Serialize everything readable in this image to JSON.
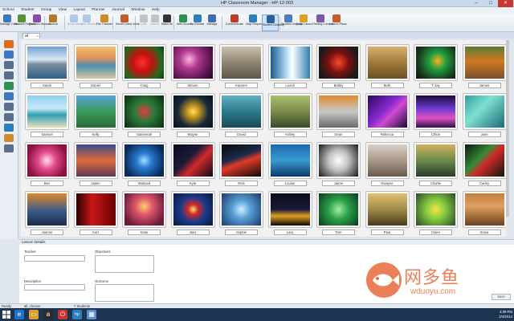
{
  "window": {
    "title": "HP Classroom Manager - HP-12-003",
    "min": "–",
    "max": "□",
    "close": "✕"
  },
  "menu": [
    "School",
    "Student",
    "Group",
    "View",
    "Layout",
    "Planner",
    "Journal",
    "Window",
    "Help"
  ],
  "toolbar": [
    {
      "label": "Manage Class",
      "icon": "manage-class-icon",
      "color": "#3a78c2"
    },
    {
      "label": "Student Register",
      "icon": "register-icon",
      "color": "#5a8f3a"
    },
    {
      "label": "Random Student",
      "icon": "dice-icon",
      "color": "#8b4aa8"
    },
    {
      "label": "Journal",
      "icon": "journal-icon",
      "color": "#b07a2a"
    },
    {
      "label": "Show Menu",
      "icon": "show-icon",
      "color": "#3a78c2",
      "disabled": true
    },
    {
      "label": "View Student",
      "icon": "view-icon",
      "color": "#3a78c2",
      "disabled": true
    },
    {
      "label": "File Transfer",
      "icon": "file-transfer-icon",
      "color": "#d18b2c"
    },
    {
      "label": "Send/Collect Work",
      "icon": "send-collect-icon",
      "color": "#c45b2a"
    },
    {
      "label": "Lock",
      "icon": "lock-icon",
      "color": "#666666",
      "disabled": true
    },
    {
      "label": "Unlock",
      "icon": "unlock-icon",
      "color": "#666666",
      "disabled": true
    },
    {
      "label": "Blank All",
      "icon": "blank-icon",
      "color": "#333333"
    },
    {
      "label": "Web Access",
      "icon": "web-icon",
      "color": "#2f8f4e"
    },
    {
      "label": "Co-Browse",
      "icon": "co-browse-icon",
      "color": "#2a7fbf"
    },
    {
      "label": "Manage",
      "icon": "manage-icon",
      "color": "#3f6fb0"
    },
    {
      "label": "Communicate",
      "icon": "chat-icon",
      "color": "#c0392b"
    },
    {
      "label": "Help Requests",
      "icon": "help-icon",
      "color": "#2a7fbf"
    },
    {
      "label": "Student Desktop",
      "icon": "desktop-icon",
      "color": "#2b5f9e",
      "active": true
    },
    {
      "label": "Student Desktop",
      "icon": "student-desktop-icon",
      "color": "#4b7db8"
    },
    {
      "label": "Quick Launch",
      "icon": "quick-launch-icon",
      "color": "#e0a020"
    },
    {
      "label": "Testing Console",
      "icon": "testing-icon",
      "color": "#7a5aa8"
    },
    {
      "label": "Lesson Plans",
      "icon": "lesson-plan-icon",
      "color": "#c45b2a"
    }
  ],
  "tab": {
    "label": "all",
    "close": "×"
  },
  "sidebar": [
    {
      "icon": "grid-view-icon",
      "color": "#e06a1e"
    },
    {
      "icon": "large-icons-icon",
      "color": "#3a78c2"
    },
    {
      "icon": "headset-icon",
      "color": "#5a6f8c"
    },
    {
      "icon": "print-icon",
      "color": "#5a6f8c"
    },
    {
      "icon": "globe-icon",
      "color": "#2f8f4e"
    },
    {
      "icon": "applications-icon",
      "color": "#3a78c2"
    },
    {
      "icon": "printer-icon",
      "color": "#5a6f8c"
    },
    {
      "icon": "devices-icon",
      "color": "#5a6f8c"
    },
    {
      "icon": "security-icon",
      "color": "#2a7fbf"
    },
    {
      "icon": "folder-icon",
      "color": "#d18b2c"
    },
    {
      "icon": "keyboard-icon",
      "color": "#5a6f8c"
    }
  ],
  "students": [
    {
      "name": "Sarah",
      "bg": "linear-gradient(#6f9fd0 0%,#d8e7f5 40%,#7b8ea0 55%,#2f5f88 100%)"
    },
    {
      "name": "Daniel",
      "bg": "linear-gradient(#f0c070 0%,#e0905a 35%,#4d8fb0 60%,#d9c9a0 100%)"
    },
    {
      "name": "Craig",
      "bg": "radial-gradient(circle at 45% 50%,#ff3030 0%,#c31010 35%,#1f6b20 75%,#0e3c10 100%)"
    },
    {
      "name": "Steven",
      "bg": "radial-gradient(circle at 40% 40%,#ffb3e0 0%,#b03a8f 30%,#5a1450 70%,#2a0626 100%)"
    },
    {
      "name": "Kareem",
      "bg": "linear-gradient(#c9c1ae 0%,#8d8473 50%,#5d5546 100%)"
    },
    {
      "name": "Leonil",
      "bg": "linear-gradient(90deg,#1a5d8f 0%,#c8e8ff 45%,#ffffff 55%,#2f7fb0 100%)"
    },
    {
      "name": "Bobby",
      "bg": "radial-gradient(circle at 50% 50%,#ff4a2a 0%,#7a1010 40%,#1a1a1a 80%)"
    },
    {
      "name": "Beth",
      "bg": "linear-gradient(#d8b070 0%,#a07a3a 50%,#6a4f25 100%)"
    },
    {
      "name": "T-Jay",
      "bg": "radial-gradient(circle at 55% 45%,#ffb020 0%,#20a040 30%,#1a3a20 70%,#0a150a 100%)"
    },
    {
      "name": "James",
      "bg": "linear-gradient(#5a7a3a 0%,#d07a20 45%,#7a5030 100%)"
    },
    {
      "name": "Samuel",
      "bg": "linear-gradient(#8fd0f0 0%,#c8eaf8 40%,#2f9fb0 60%,#e8e0c0 100%)"
    },
    {
      "name": "Kelly",
      "bg": "linear-gradient(#5aa0d8 0%,#3a9a5a 50%,#2a6a3a 100%)"
    },
    {
      "name": "Sameerah",
      "bg": "radial-gradient(circle at 50% 50%,#e04040 0%,#2a7a3a 40%,#0a2a10 100%)"
    },
    {
      "name": "Wayne",
      "bg": "radial-gradient(circle at 50% 50%,#ffe060 0%,#d0a020 20%,#1a2a3a 60%,#0a1018 100%)"
    },
    {
      "name": "David",
      "bg": "linear-gradient(#5fb0c0 0%,#2a7a8a 50%,#1a4a55 100%)"
    },
    {
      "name": "Ashley",
      "bg": "linear-gradient(#a8c070 0%,#7a8a4a 50%,#3a4a2a 100%)"
    },
    {
      "name": "Dean",
      "bg": "linear-gradient(#e08a30 0%,#c8c8c8 50%,#6a6a6a 100%)"
    },
    {
      "name": "Rebecca",
      "bg": "linear-gradient(135deg,#2a0a5a 0%,#8a2ad0 45%,#d04ad0 60%,#1a0a3a 100%)"
    },
    {
      "name": "Chloe",
      "bg": "linear-gradient(#1a0a3a 0%,#6a3ad0 40%,#e050c0 70%,#2a1050 100%)"
    },
    {
      "name": "Jane",
      "bg": "linear-gradient(135deg,#30a0a0 0%,#80e0d0 40%,#1a6a7a 100%)"
    },
    {
      "name": "Bev",
      "bg": "radial-gradient(circle at 50% 50%,#ffe0f0 0%,#e04a8a 35%,#8a1040 80%)"
    },
    {
      "name": "Jason",
      "bg": "linear-gradient(#3a4a8a 0%,#e06a3a 50%,#5a3a5a 100%)"
    },
    {
      "name": "Waheed",
      "bg": "radial-gradient(circle at 50% 50%,#a0e0ff 0%,#2a7ad0 30%,#0a2a5a 80%)"
    },
    {
      "name": "Kyla",
      "bg": "linear-gradient(135deg,#0a0a1a 0%,#1a1a3a 40%,#d02a2a 60%,#0a0a1a 100%)"
    },
    {
      "name": "Reis",
      "bg": "linear-gradient(160deg,#0a0a0a 0%,#1a2a4a 40%,#e03a2a 55%,#0a0a0a 100%)"
    },
    {
      "name": "Louise",
      "bg": "linear-gradient(#1a6ab0 0%,#3a9ad0 50%,#0a3a6a 100%)"
    },
    {
      "name": "Jaime",
      "bg": "radial-gradient(circle at 50% 50%,#ffffff 0%,#c0c0c0 40%,#1a1a1a 100%)"
    },
    {
      "name": "Dwayne",
      "bg": "linear-gradient(#d8d0c8 0%,#a89888 50%,#6a5a4a 100%)"
    },
    {
      "name": "Charlie",
      "bg": "linear-gradient(#d0b060 0%,#6a8a4a 50%,#2a3a2a 100%)"
    },
    {
      "name": "Carley",
      "bg": "linear-gradient(135deg,#0a1a0a 0%,#3a8a3a 40%,#d02a2a 55%,#0a1a0a 100%)"
    },
    {
      "name": "Joanne",
      "bg": "linear-gradient(#e08a2a 0%,#3a5a8a 55%,#1a2a4a 100%)"
    },
    {
      "name": "Karl",
      "bg": "linear-gradient(90deg,#2a0000 0%,#c81818 40%,#6a0000 100%)"
    },
    {
      "name": "Kane",
      "bg": "radial-gradient(circle at 50% 40%,#ffd070 0%,#e05a6a 30%,#6a1a3a 80%)"
    },
    {
      "name": "Jaez",
      "bg": "radial-gradient(circle at 50% 50%,#ffe070 0%,#d02a2a 20%,#1a3a8a 50%,#0a1a3a 100%)"
    },
    {
      "name": "Sophie",
      "bg": "radial-gradient(circle at 50% 50%,#d0f0ff 0%,#5aa0d8 35%,#1a3a6a 100%)"
    },
    {
      "name": "Lara",
      "bg": "linear-gradient(#0a0a1a 0%,#1a1a3a 50%,#e0a020 70%,#0a0a0a 100%)"
    },
    {
      "name": "Tom",
      "bg": "radial-gradient(circle at 50% 50%,#a0f0a0 0%,#2aa04a 40%,#0a3a1a 100%)"
    },
    {
      "name": "Paul",
      "bg": "linear-gradient(#e0c070 0%,#a08a4a 50%,#4a3a1a 100%)"
    },
    {
      "name": "Claire",
      "bg": "radial-gradient(circle at 50% 50%,#ffe040 0%,#8ad040 35%,#2a4a2a 100%)"
    },
    {
      "name": "Sonia",
      "bg": "linear-gradient(#c08040 0%,#e0a060 40%,#6a4020 100%)"
    }
  ],
  "lesson": {
    "header": "Lesson Details",
    "teacher_label": "Teacher",
    "objectives_label": "Objectives",
    "description_label": "Description",
    "outcome_label": "Outcome",
    "save_label": "Save"
  },
  "status": {
    "ready": "Ready",
    "group": "all, chrome",
    "students": "7 Students"
  },
  "taskbar": {
    "apps": [
      {
        "icon": "ie-icon",
        "glyph": "e",
        "color": "#1f73c7"
      },
      {
        "icon": "file-explorer-icon",
        "glyph": "▭",
        "color": "#d8a030"
      },
      {
        "icon": "amazon-icon",
        "glyph": "a",
        "color": "#2a2a2a"
      },
      {
        "icon": "power-icon",
        "glyph": "⏻",
        "color": "#c0392b"
      },
      {
        "icon": "hp-icon",
        "glyph": "hp",
        "color": "#2a7fbf"
      },
      {
        "icon": "classroom-manager-icon",
        "glyph": "▦",
        "color": "#5a8fd0"
      }
    ],
    "time": "3:39 PM",
    "date": "2/4/2014"
  },
  "watermark": {
    "title": "网多鱼",
    "url": "wduoyu.com",
    "color": "#e86a3b"
  }
}
